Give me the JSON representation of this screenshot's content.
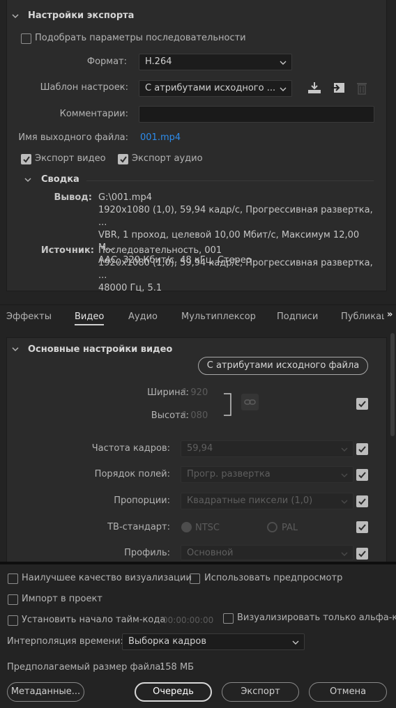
{
  "export_settings": {
    "header": "Настройки экспорта",
    "match_sequence_label": "Подобрать параметры последовательности",
    "format_label": "Формат:",
    "format_value": "H.264",
    "preset_label": "Шаблон настроек:",
    "preset_value": "С атрибутами исходного ...",
    "comments_label": "Комментарии:",
    "comments_value": "",
    "output_name_label": "Имя выходного файла:",
    "output_name_value": "001.mp4",
    "export_video_label": "Экспорт видео",
    "export_audio_label": "Экспорт аудио",
    "export_video_checked": true,
    "export_audio_checked": true,
    "match_sequence_checked": false
  },
  "summary": {
    "header": "Сводка",
    "output_label": "Вывод:",
    "output_lines": [
      "G:\\001.mp4",
      "1920x1080 (1,0), 59,94 кадр/с, Прогрессивная развертка, ...",
      "VBR, 1 проход, целевой 10,00 Мбит/с, Максимум 12,00 М...",
      "AAC, 320 Кбит/с, 48 кГц, Стерео"
    ],
    "source_label": "Источник:",
    "source_lines": [
      "Последовательность, 001",
      "1920x1080 (1,0), 59,94 кадр/с, Прогрессивная развертка, ...",
      "48000 Гц, 5.1"
    ]
  },
  "tabs": [
    {
      "label": "Эффекты",
      "active": false
    },
    {
      "label": "Видео",
      "active": true
    },
    {
      "label": "Аудио",
      "active": false
    },
    {
      "label": "Мультиплексор",
      "active": false
    },
    {
      "label": "Подписи",
      "active": false
    },
    {
      "label": "Публикац",
      "active": false
    }
  ],
  "tabs_more": "»",
  "video": {
    "header": "Основные настройки видео",
    "match_source_button": "С атрибутами исходного файла",
    "width_label": "Ширина:",
    "width_value": "1 920",
    "height_label": "Высота:",
    "height_value": "1 080",
    "framerate_label": "Частота кадров:",
    "framerate_value": "59,94",
    "field_order_label": "Порядок полей:",
    "field_order_value": "Прогр. развертка",
    "aspect_label": "Пропорции:",
    "aspect_value": "Квадратные пиксели (1,0)",
    "tv_standard_label": "ТВ-стандарт:",
    "ntsc_label": "NTSC",
    "pal_label": "PAL",
    "profile_label": "Профиль:",
    "profile_value": "Основной"
  },
  "bottom": {
    "max_render_label": "Наилучшее качество визуализации",
    "use_previews_label": "Использовать предпросмотр",
    "import_project_label": "Импорт в проект",
    "set_timecode_label": "Установить начало тайм-кода",
    "timecode_value": "00:00:00:00",
    "alpha_only_label": "Визуализировать только альфа-кан",
    "interpolation_label": "Интерполяция времени:",
    "interpolation_value": "Выборка кадров",
    "filesize_label": "Предполагаемый размер файла:",
    "filesize_value": "158 МБ",
    "metadata_button": "Метаданные...",
    "queue_button": "Очередь",
    "export_button": "Экспорт",
    "cancel_button": "Отмена"
  }
}
